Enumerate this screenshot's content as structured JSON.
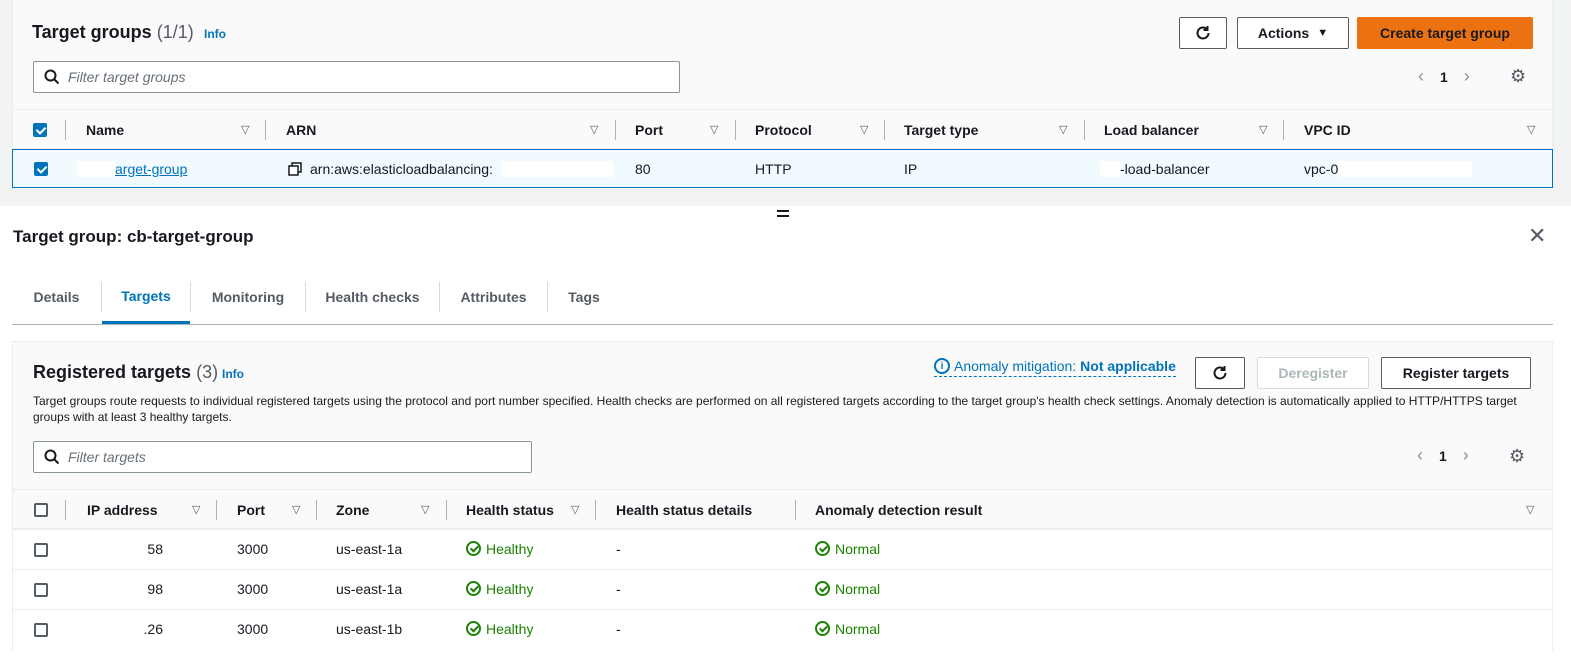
{
  "target_groups": {
    "title": "Target groups",
    "count": "(1/1)",
    "info": "Info",
    "actions_label": "Actions",
    "create_label": "Create target group",
    "filter_placeholder": "Filter target groups",
    "page": "1",
    "columns": [
      "Name",
      "ARN",
      "Port",
      "Protocol",
      "Target type",
      "Load balancer",
      "VPC ID"
    ],
    "row": {
      "name": "arget-group",
      "arn": "arn:aws:elasticloadbalancing:",
      "port": "80",
      "protocol": "HTTP",
      "target_type": "IP",
      "load_balancer": "-load-balancer",
      "vpc_id": "vpc-0"
    }
  },
  "detail": {
    "title": "Target group: cb-target-group",
    "tabs": [
      "Details",
      "Targets",
      "Monitoring",
      "Health checks",
      "Attributes",
      "Tags"
    ],
    "active_tab": "Targets"
  },
  "registered_targets": {
    "title": "Registered targets",
    "count": "(3)",
    "info": "Info",
    "anomaly_label": "Anomaly mitigation:",
    "anomaly_value": "Not applicable",
    "deregister_label": "Deregister",
    "register_label": "Register targets",
    "description": "Target groups route requests to individual registered targets using the protocol and port number specified. Health checks are performed on all registered targets according to the target group's health check settings. Anomaly detection is automatically applied to HTTP/HTTPS target groups with at least 3 healthy targets.",
    "filter_placeholder": "Filter targets",
    "page": "1",
    "columns": [
      "IP address",
      "Port",
      "Zone",
      "Health status",
      "Health status details",
      "Anomaly detection result"
    ],
    "rows": [
      {
        "ip": "58",
        "port": "3000",
        "zone": "us-east-1a",
        "health": "Healthy",
        "details": "-",
        "anomaly": "Normal"
      },
      {
        "ip": "98",
        "port": "3000",
        "zone": "us-east-1a",
        "health": "Healthy",
        "details": "-",
        "anomaly": "Normal"
      },
      {
        "ip": ".26",
        "port": "3000",
        "zone": "us-east-1b",
        "health": "Healthy",
        "details": "-",
        "anomaly": "Normal"
      }
    ]
  },
  "icons": {
    "refresh": "refresh-icon",
    "settings": "gear-icon",
    "close": "close-icon",
    "copy": "copy-icon",
    "search": "search-icon"
  },
  "colors": {
    "accent": "#0073bb",
    "primary_button": "#ec7211",
    "success": "#1d8102"
  }
}
